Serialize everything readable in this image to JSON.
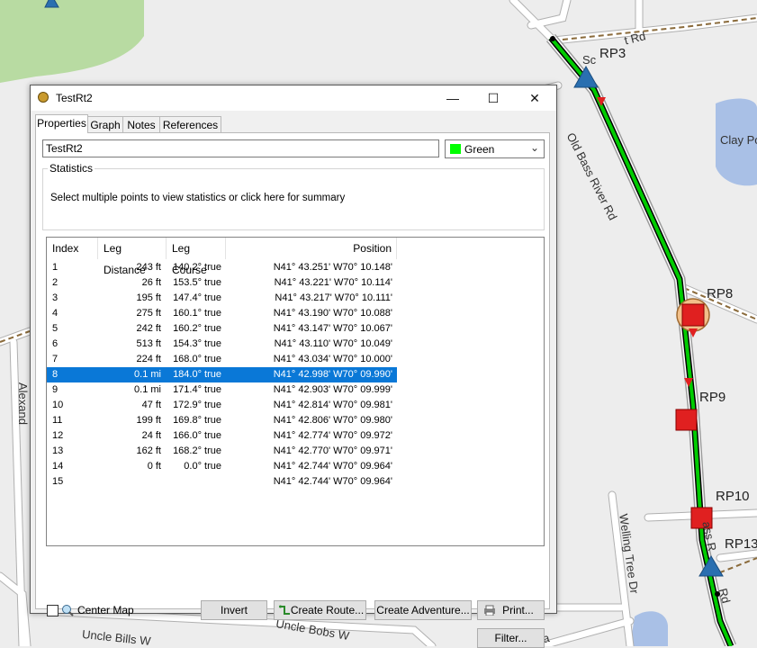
{
  "map": {
    "route_points": [
      "RP3",
      "RP8",
      "RP9",
      "RP10",
      "RP13"
    ],
    "road_labels": [
      "Old Bass River Rd",
      "Welling Tree Dr",
      "Uncle Bobs W",
      "Uncle Bills W",
      "Clay Po",
      "Alexand",
      "Sc",
      "t Rd",
      "ass R",
      "Rd",
      "Wa"
    ]
  },
  "window": {
    "title": "TestRt2",
    "minimize": "—",
    "maximize": "☐",
    "close": "✕"
  },
  "tabs": [
    "Properties",
    "Graph",
    "Notes",
    "References"
  ],
  "properties": {
    "name_value": "TestRt2",
    "color_label": "Green",
    "color_hex": "#00ff00",
    "statistics_legend": "Statistics",
    "statistics_text": "Select multiple points to view statistics or click here for summary"
  },
  "table": {
    "headers": [
      "Index",
      "Leg Distance",
      "Leg Course",
      "Position"
    ],
    "selected_index": "8",
    "rows": [
      {
        "index": "1",
        "dist": "243 ft",
        "course": "140.2° true",
        "pos": "N41° 43.251' W70° 10.148'"
      },
      {
        "index": "2",
        "dist": "26 ft",
        "course": "153.5° true",
        "pos": "N41° 43.221' W70° 10.114'"
      },
      {
        "index": "3",
        "dist": "195 ft",
        "course": "147.4° true",
        "pos": "N41° 43.217' W70° 10.111'"
      },
      {
        "index": "4",
        "dist": "275 ft",
        "course": "160.1° true",
        "pos": "N41° 43.190' W70° 10.088'"
      },
      {
        "index": "5",
        "dist": "242 ft",
        "course": "160.2° true",
        "pos": "N41° 43.147' W70° 10.067'"
      },
      {
        "index": "6",
        "dist": "513 ft",
        "course": "154.3° true",
        "pos": "N41° 43.110' W70° 10.049'"
      },
      {
        "index": "7",
        "dist": "224 ft",
        "course": "168.0° true",
        "pos": "N41° 43.034' W70° 10.000'"
      },
      {
        "index": "8",
        "dist": "0.1 mi",
        "course": "184.0° true",
        "pos": "N41° 42.998' W70° 09.990'"
      },
      {
        "index": "9",
        "dist": "0.1 mi",
        "course": "171.4° true",
        "pos": "N41° 42.903' W70° 09.999'"
      },
      {
        "index": "10",
        "dist": "47 ft",
        "course": "172.9° true",
        "pos": "N41° 42.814' W70° 09.981'"
      },
      {
        "index": "11",
        "dist": "199 ft",
        "course": "169.8° true",
        "pos": "N41° 42.806' W70° 09.980'"
      },
      {
        "index": "12",
        "dist": "24 ft",
        "course": "166.0° true",
        "pos": "N41° 42.774' W70° 09.972'"
      },
      {
        "index": "13",
        "dist": "162 ft",
        "course": "168.2° true",
        "pos": "N41° 42.770' W70° 09.971'"
      },
      {
        "index": "14",
        "dist": "0 ft",
        "course": "0.0° true",
        "pos": "N41° 42.744' W70° 09.964'"
      },
      {
        "index": "15",
        "dist": "",
        "course": "",
        "pos": "N41° 42.744' W70° 09.964'"
      }
    ]
  },
  "footer": {
    "center_map_label": "Center Map",
    "invert": "Invert",
    "create_route": "Create Route...",
    "create_adventure": "Create Adventure...",
    "print": "Print...",
    "filter": "Filter..."
  },
  "colors": {
    "selection": "#0a78d7",
    "route_line": "#00cc00",
    "water": "#a9c0e6",
    "park": "#b8dba2"
  }
}
